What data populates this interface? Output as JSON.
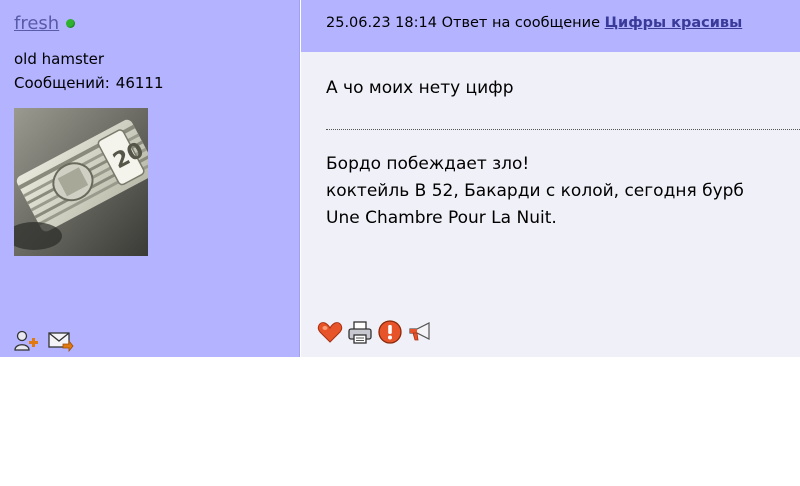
{
  "user": {
    "name": "fresh",
    "title": "old hamster",
    "messages_label": "Сообщений:",
    "messages_count": "46111"
  },
  "post": {
    "date": "25.06.23 18:14",
    "reply_prefix": "Ответ на сообщение",
    "reply_link": "Цифры красивы",
    "text": "А чо моих нету цифр",
    "signature": [
      "Бордо побеждает зло!",
      "коктейль В 52, Бакарди с колой, сегодня бурб",
      "Une Chambre Pour La Nuit."
    ]
  },
  "icons": {
    "user": [
      "add-friend-icon",
      "send-message-icon"
    ],
    "post": [
      "heart-icon",
      "print-icon",
      "report-icon",
      "megaphone-icon"
    ]
  },
  "colors": {
    "sidebar_bg": "#b3b3ff",
    "content_bg": "#f0f0f8",
    "link": "#3a3a99",
    "online": "#2fb32f"
  }
}
